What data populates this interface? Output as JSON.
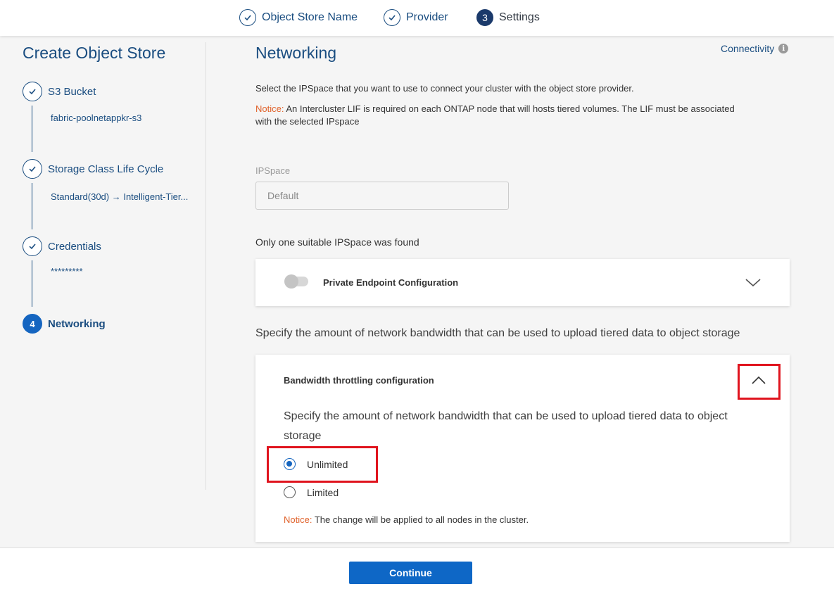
{
  "stepper": {
    "steps": [
      {
        "label": "Object Store Name",
        "state": "done",
        "icon": "check-icon"
      },
      {
        "label": "Provider",
        "state": "done",
        "icon": "check-icon"
      },
      {
        "label": "Settings",
        "state": "current",
        "number": "3"
      }
    ]
  },
  "sidebar": {
    "title": "Create Object Store",
    "steps": [
      {
        "label": "S3 Bucket",
        "value": "fabric-poolnetappkr-s3",
        "state": "done"
      },
      {
        "label": "Storage Class Life Cycle",
        "value": "Standard(30d) → Intelligent-Tier...",
        "state": "done"
      },
      {
        "label": "Credentials",
        "value": "*********",
        "state": "done"
      },
      {
        "label": "Networking",
        "number": "4",
        "state": "current"
      }
    ]
  },
  "main": {
    "title": "Networking",
    "connectivity_link": "Connectivity",
    "description": "Select the IPSpace that you want to use to connect your cluster with the object store provider.",
    "notice_label": "Notice:",
    "notice_text": " An Intercluster LIF is required on each ONTAP node that will hosts tiered volumes. The LIF must be associated with the selected IPspace",
    "ipspace": {
      "label": "IPSpace",
      "value": "Default"
    },
    "found_text": "Only one suitable IPSpace was found",
    "private_endpoint": {
      "title": "Private Endpoint Configuration",
      "enabled": false
    },
    "bandwidth_description": "Specify the amount of network bandwidth that can be used to upload tiered data to object storage",
    "bandwidth_card": {
      "title": "Bandwidth throttling configuration",
      "description": "Specify the amount of network bandwidth that can be used to upload tiered data to object storage",
      "options": [
        {
          "label": "Unlimited",
          "selected": true
        },
        {
          "label": "Limited",
          "selected": false
        }
      ],
      "notice_label": "Notice:",
      "notice_text": " The change will be applied to all nodes in the cluster."
    }
  },
  "footer": {
    "continue_label": "Continue"
  },
  "colors": {
    "brand_blue": "#1a4d80",
    "primary_button": "#0e67c6",
    "notice_orange": "#e0622b",
    "highlight_red": "#e0141e"
  }
}
